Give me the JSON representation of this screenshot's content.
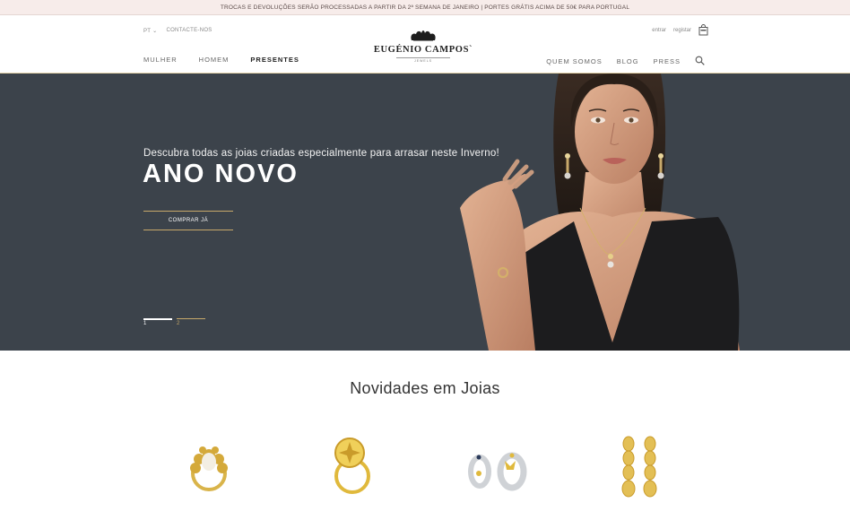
{
  "announcement": "TROCAS E DEVOLUÇÕES SERÃO PROCESSADAS A PARTIR DA 2ª SEMANA DE JANEIRO | PORTES GRÁTIS ACIMA DE 50€ PARA PORTUGAL",
  "header": {
    "language": "PT ⌄",
    "contact": "CONTACTE-NOS",
    "login": "entrar",
    "register": "registar",
    "logo_name": "EUGÉNIO CAMPOS`",
    "logo_sub": "JEWELS",
    "nav_left": [
      "MULHER",
      "HOMEM",
      "PRESENTES"
    ],
    "nav_right": [
      "QUEM SOMOS",
      "BLOG",
      "PRESS"
    ],
    "icons": [
      "bag-icon",
      "search-icon"
    ]
  },
  "hero": {
    "subtitle": "Descubra todas as joias criadas especialmente para arrasar neste Inverno!",
    "title": "ANO NOVO",
    "cta": "COMPRAR JÁ",
    "pages": [
      "1",
      "2"
    ],
    "active_page": "1",
    "colors": {
      "background": "#3c434b",
      "gold": "#c8a96a"
    }
  },
  "section": {
    "title": "Novidades em Joias"
  },
  "products": [
    "ring-with-pearl",
    "star-ring",
    "hoop-earrings",
    "textured-drop-earrings"
  ]
}
